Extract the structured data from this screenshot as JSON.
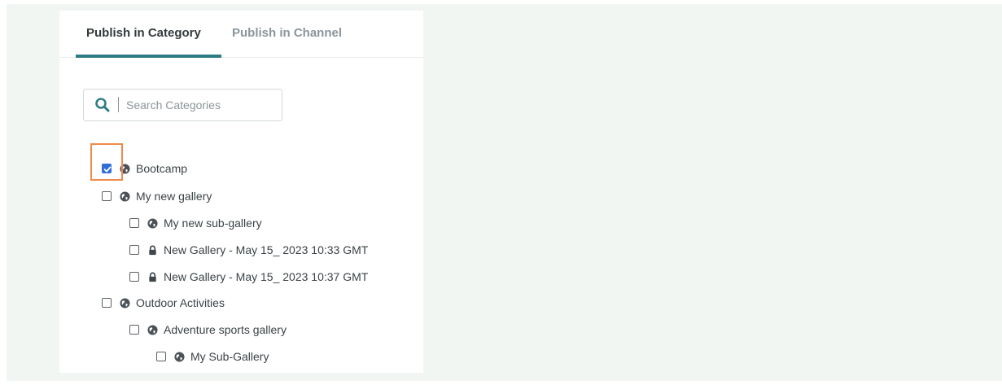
{
  "tabs": [
    {
      "label": "Publish in Category",
      "active": true
    },
    {
      "label": "Publish in Channel",
      "active": false
    }
  ],
  "search": {
    "placeholder": "Search Categories",
    "value": "",
    "icon": "search-icon"
  },
  "tree": [
    {
      "label": "Bootcamp",
      "checked": true,
      "icon": "globe-icon",
      "depth": 0
    },
    {
      "label": "My new gallery",
      "checked": false,
      "icon": "globe-icon",
      "depth": 1
    },
    {
      "label": "My new sub-gallery",
      "checked": false,
      "icon": "globe-icon",
      "depth": 2
    },
    {
      "label": "New Gallery - May 15_ 2023 10:33 GMT",
      "checked": false,
      "icon": "lock-icon",
      "depth": 2
    },
    {
      "label": "New Gallery - May 15_ 2023 10:37 GMT",
      "checked": false,
      "icon": "lock-icon",
      "depth": 2
    },
    {
      "label": "Outdoor Activities",
      "checked": false,
      "icon": "globe-icon",
      "depth": 1
    },
    {
      "label": "Adventure sports gallery",
      "checked": false,
      "icon": "globe-icon",
      "depth": 2
    },
    {
      "label": "My Sub-Gallery",
      "checked": false,
      "icon": "globe-icon",
      "depth": 3
    }
  ],
  "colors": {
    "accent": "#2e7c83",
    "checkbox_checked": "#2f6fd6",
    "highlight": "#f08a4b",
    "background": "#f1f6f3"
  }
}
